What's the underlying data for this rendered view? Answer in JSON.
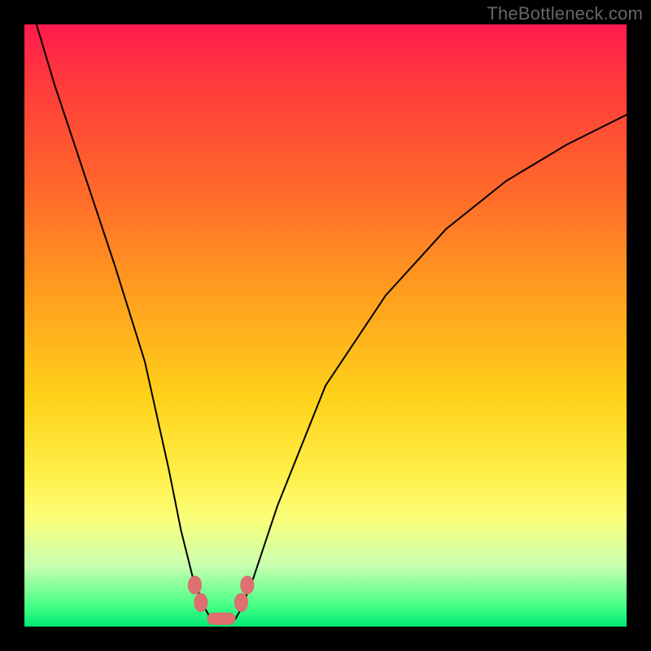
{
  "watermark": "TheBottleneck.com",
  "chart_data": {
    "type": "line",
    "title": "",
    "xlabel": "",
    "ylabel": "",
    "xlim": [
      0,
      100
    ],
    "ylim": [
      0,
      100
    ],
    "series": [
      {
        "name": "bottleneck-curve",
        "x": [
          2,
          5,
          10,
          15,
          20,
          24,
          26,
          28,
          30,
          31,
          32,
          33,
          34,
          35,
          36,
          38,
          42,
          50,
          60,
          70,
          80,
          90,
          100
        ],
        "y": [
          100,
          90,
          75,
          60,
          44,
          26,
          16,
          8,
          3,
          1.2,
          0.8,
          0.8,
          0.8,
          1.2,
          3,
          8,
          20,
          40,
          55,
          66,
          74,
          80,
          85
        ]
      }
    ],
    "markers": [
      {
        "name": "left-upper-dot",
        "x": 28.3,
        "y": 6.9
      },
      {
        "name": "left-lower-dot",
        "x": 29.3,
        "y": 4.0
      },
      {
        "name": "right-lower-dot",
        "x": 36.0,
        "y": 4.0
      },
      {
        "name": "right-upper-dot",
        "x": 37.0,
        "y": 6.9
      }
    ],
    "trough_bar": {
      "x_start": 30.4,
      "x_end": 35.0,
      "y": 1.3
    },
    "colors": {
      "curve": "#000000",
      "marker_fill": "#e07070",
      "marker_stroke": "#d86868"
    }
  }
}
